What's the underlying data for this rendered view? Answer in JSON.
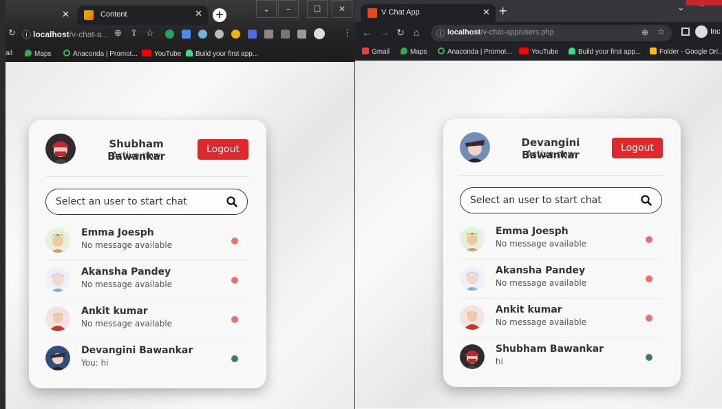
{
  "left_window": {
    "tab_title": "Content",
    "address": {
      "host": "localhost",
      "path": "/v-chat-a..."
    },
    "bookmarks": [
      "ail",
      "Maps",
      "Anaconda | Promot...",
      "YouTube",
      "Build your first app..."
    ],
    "header": {
      "name": "Shubham Bawankar",
      "status": "Active now",
      "logout_label": "Logout"
    },
    "search": {
      "placeholder": "Select an user to start chat"
    },
    "users": [
      {
        "name": "Emma Joesph",
        "message": "No message available",
        "status": "offline"
      },
      {
        "name": "Akansha Pandey",
        "message": "No message available",
        "status": "offline"
      },
      {
        "name": "Ankit kumar",
        "message": "No message available",
        "status": "offline"
      },
      {
        "name": "Devangini Bawankar",
        "message": "You: hi",
        "status": "online"
      }
    ]
  },
  "right_window": {
    "tab_title": "V Chat App",
    "address": {
      "host": "localhost",
      "path": "/v-chat-app/users.php"
    },
    "bookmarks": [
      "Gmail",
      "Maps",
      "Anaconda | Promot...",
      "YouTube",
      "Build your first app...",
      "Folder - Google Dri..."
    ],
    "profile_label": "Inc",
    "header": {
      "name": "Devangini Bawankar",
      "status": "Active now",
      "logout_label": "Logout"
    },
    "search": {
      "placeholder": "Select an user to start chat"
    },
    "users": [
      {
        "name": "Emma Joesph",
        "message": "No message available",
        "status": "offline"
      },
      {
        "name": "Akansha Pandey",
        "message": "No message available",
        "status": "offline"
      },
      {
        "name": "Ankit kumar",
        "message": "No message available",
        "status": "offline"
      },
      {
        "name": "Shubham Bawankar",
        "message": "hi",
        "status": "online"
      }
    ]
  },
  "colors": {
    "logout": "#e0282c",
    "offline": "#ec6f6f",
    "online": "#3f7d5a"
  }
}
